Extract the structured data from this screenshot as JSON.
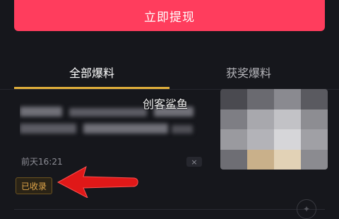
{
  "header": {
    "withdraw_label": "立即提现"
  },
  "tabs": [
    {
      "label": "全部爆料",
      "active": true
    },
    {
      "label": "获奖爆料",
      "active": false
    }
  ],
  "watermark": "创客鲨鱼",
  "post": {
    "time": "前天16:21",
    "status_badge": "已收录",
    "close_symbol": "×"
  },
  "colors": {
    "accent": "#ff3d5d",
    "tab_indicator": "#e1b03b",
    "badge_text": "#e1a64a",
    "arrow": "#e01818"
  },
  "icons": {
    "close": "close-icon",
    "arrow": "red-arrow-pointer",
    "logo": "watermark-logo-icon"
  }
}
